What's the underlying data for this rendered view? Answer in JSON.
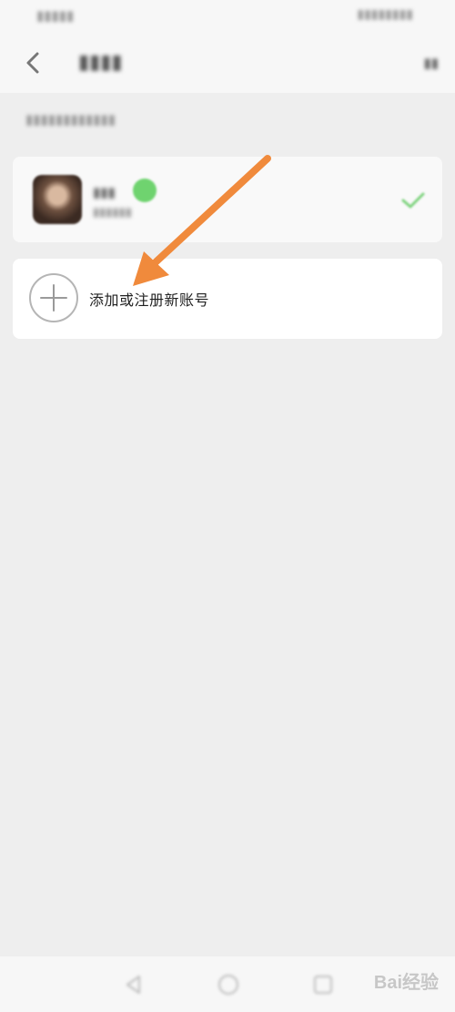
{
  "add_account": {
    "label": "添加或注册新账号"
  },
  "watermark": {
    "text": "Bai经验"
  },
  "colors": {
    "arrow": "#f08a3c",
    "online_badge": "#6fd36f",
    "check": "#7fd37f",
    "background": "#eeeeee"
  },
  "icons": {
    "back": "chevron-left-icon",
    "add": "plus-circle-icon",
    "selected": "check-icon",
    "nav_back": "triangle-back-icon",
    "nav_home": "circle-home-icon",
    "nav_recent": "square-recent-icon"
  }
}
